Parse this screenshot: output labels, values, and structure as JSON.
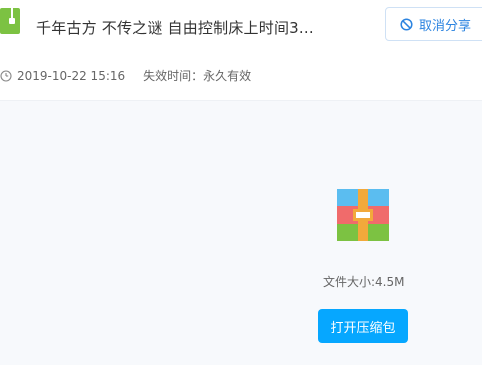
{
  "header": {
    "title": "千年古方 不传之谜 自由控制床上时间3...",
    "cancel_share_label": "取消分享",
    "share_time": "2019-10-22 15:16",
    "expire_label": "失效时间：永久有效"
  },
  "file": {
    "size_label": "文件大小:4.5M",
    "open_button_label": "打开压缩包"
  },
  "icons": {
    "file_type": "zip-file-icon",
    "cancel_share": "prohibit-icon",
    "clock": "clock-icon",
    "archive": "rar-archive-icon"
  },
  "colors": {
    "accent": "#06a7ff",
    "link_blue": "#2c84e0",
    "zip_green": "#7cc242"
  }
}
